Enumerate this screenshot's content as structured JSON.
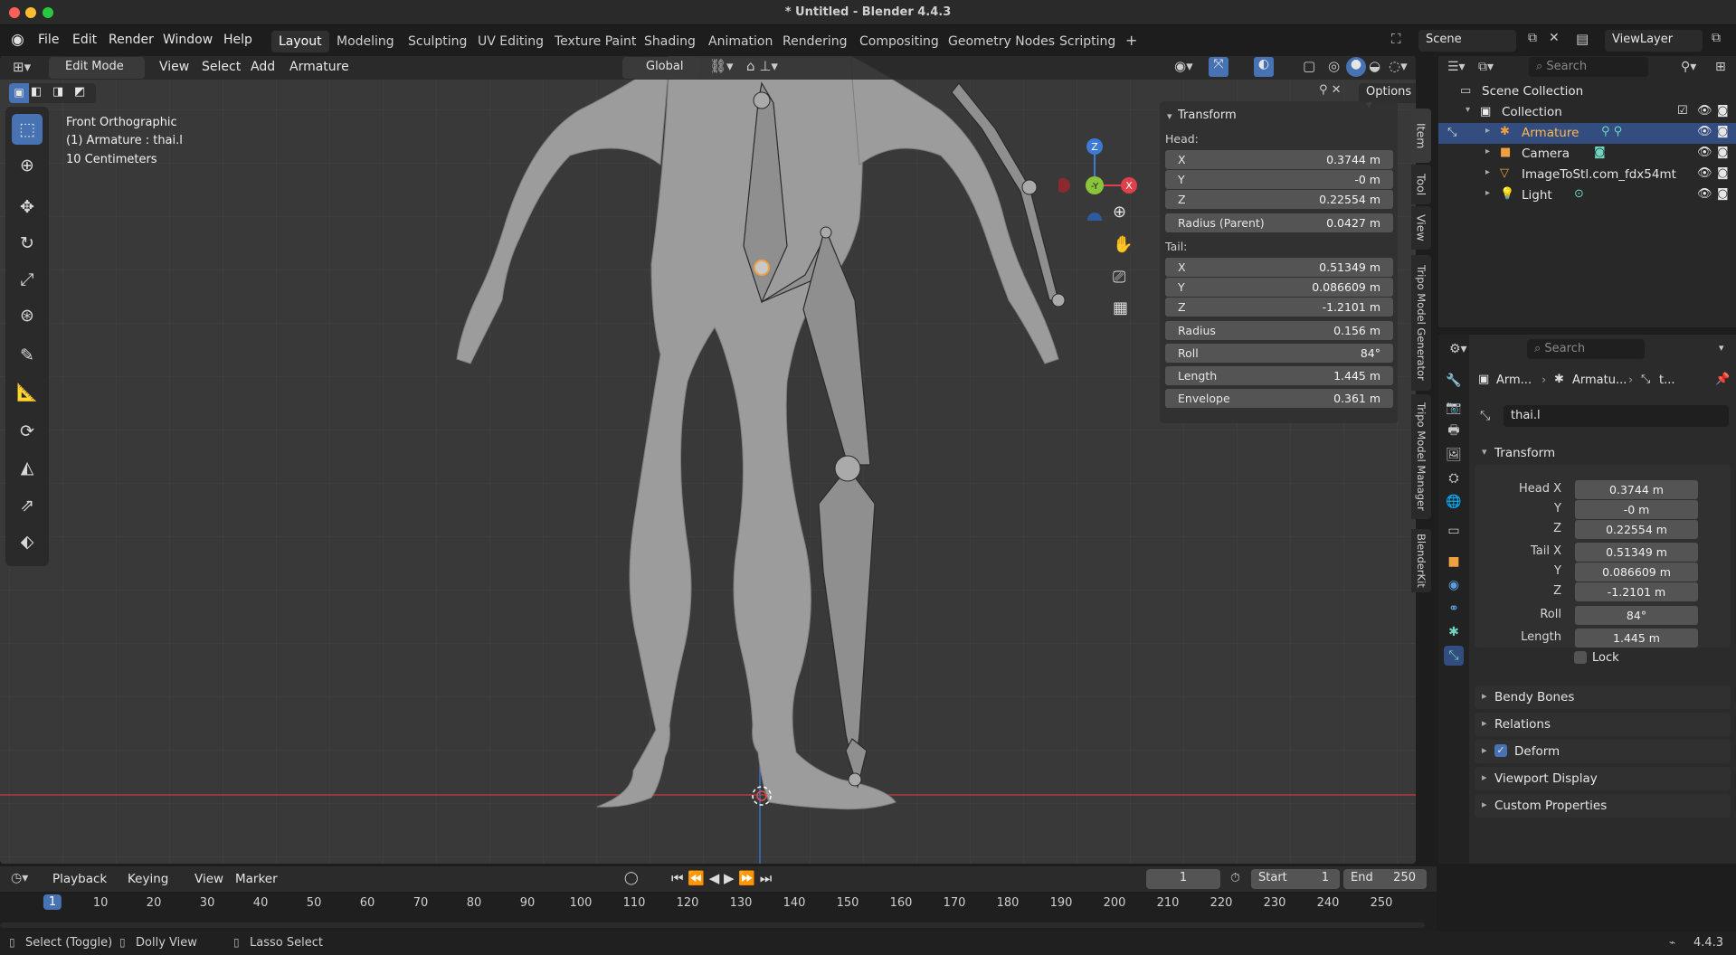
{
  "window": {
    "title": "* Untitled - Blender 4.4.3"
  },
  "menubar": {
    "menus": [
      "File",
      "Edit",
      "Render",
      "Window",
      "Help"
    ],
    "workspaces": [
      "Layout",
      "Modeling",
      "Sculpting",
      "UV Editing",
      "Texture Paint",
      "Shading",
      "Animation",
      "Rendering",
      "Compositing",
      "Geometry Nodes",
      "Scripting"
    ],
    "active_workspace": "Layout",
    "add_workspace": "+",
    "scene": "Scene",
    "view_layer": "ViewLayer"
  },
  "viewport_header": {
    "mode": "Edit Mode",
    "menus": [
      "View",
      "Select",
      "Add",
      "Armature"
    ],
    "orientation": "Global",
    "options": "Options"
  },
  "viewport_overlay": {
    "view_name": "Front Orthographic",
    "object_info": "(1) Armature : thai.l",
    "scale": "10 Centimeters"
  },
  "gizmo": {
    "z": "Z",
    "y": "-Y",
    "x": "X"
  },
  "npanel": {
    "title": "Transform",
    "head_label": "Head:",
    "head": [
      {
        "k": "X",
        "v": "0.3744 m"
      },
      {
        "k": "Y",
        "v": "-0 m"
      },
      {
        "k": "Z",
        "v": "0.22554 m"
      },
      {
        "k": "Radius (Parent)",
        "v": "0.0427 m"
      }
    ],
    "tail_label": "Tail:",
    "tail": [
      {
        "k": "X",
        "v": "0.51349 m"
      },
      {
        "k": "Y",
        "v": "0.086609 m"
      },
      {
        "k": "Z",
        "v": "-1.2101 m"
      },
      {
        "k": "Radius",
        "v": "0.156 m"
      },
      {
        "k": "Roll",
        "v": "84°"
      },
      {
        "k": "Length",
        "v": "1.445 m"
      },
      {
        "k": "Envelope",
        "v": "0.361 m"
      }
    ],
    "tabs": [
      "Item",
      "Tool",
      "View",
      "Tripo Model Generator",
      "Tripo Model Manager",
      "BlenderKit"
    ]
  },
  "outliner": {
    "search_placeholder": "Search",
    "root": "Scene Collection",
    "collection": "Collection",
    "items": [
      "Armature",
      "Camera",
      "ImageToStl.com_fdx54mt",
      "Light"
    ]
  },
  "properties": {
    "search_placeholder": "Search",
    "breadcrumb": [
      "Arm...",
      "Armatu...",
      "t..."
    ],
    "bone_name": "thai.l",
    "transform_title": "Transform",
    "fields": [
      {
        "k": "Head X",
        "v": "0.3744 m"
      },
      {
        "k": "Y",
        "v": "-0 m"
      },
      {
        "k": "Z",
        "v": "0.22554 m"
      },
      {
        "k": "Tail X",
        "v": "0.51349 m"
      },
      {
        "k": "Y",
        "v": "0.086609 m"
      },
      {
        "k": "Z",
        "v": "-1.2101 m"
      },
      {
        "k": "Roll",
        "v": "84°"
      },
      {
        "k": "Length",
        "v": "1.445 m"
      }
    ],
    "lock_label": "Lock",
    "panels": [
      "Bendy Bones",
      "Relations",
      "Deform",
      "Viewport Display",
      "Custom Properties"
    ]
  },
  "timeline": {
    "menus": [
      "Playback",
      "Keying",
      "View",
      "Marker"
    ],
    "current_frame": "1",
    "start_label": "Start",
    "start": "1",
    "end_label": "End",
    "end": "250",
    "ticks": [
      "1",
      "10",
      "20",
      "30",
      "40",
      "50",
      "60",
      "70",
      "80",
      "90",
      "100",
      "110",
      "120",
      "130",
      "140",
      "150",
      "160",
      "170",
      "180",
      "190",
      "200",
      "210",
      "220",
      "230",
      "240",
      "250"
    ]
  },
  "statusbar": {
    "items": [
      "Select (Toggle)",
      "Dolly View",
      "Lasso Select"
    ],
    "version": "4.4.3"
  },
  "colors": {
    "accent": "#4772b3",
    "selected_orange": "#f0a040",
    "axis_x": "#e0404a",
    "axis_y": "#8ac43a",
    "axis_z": "#3d7ad6"
  }
}
